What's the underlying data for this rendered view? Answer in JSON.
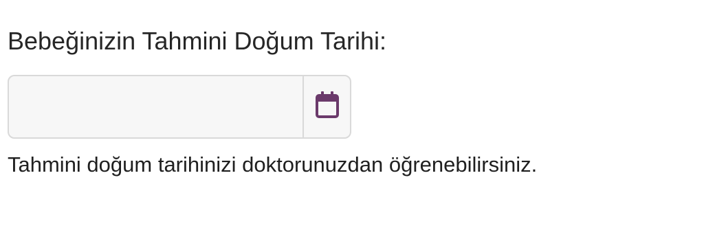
{
  "form": {
    "label": "Bebeğinizin Tahmini Doğum Tarihi:",
    "date_input": {
      "value": "",
      "placeholder": ""
    },
    "calendar_icon": "calendar-icon",
    "help_text": "Tahmini doğum tarihinizi doktorunuzdan öğrenebilirsiniz."
  },
  "colors": {
    "accent": "#6b3a6b",
    "input_background": "#f7f7f7",
    "input_border": "#d9d9d9",
    "text": "#262626"
  }
}
